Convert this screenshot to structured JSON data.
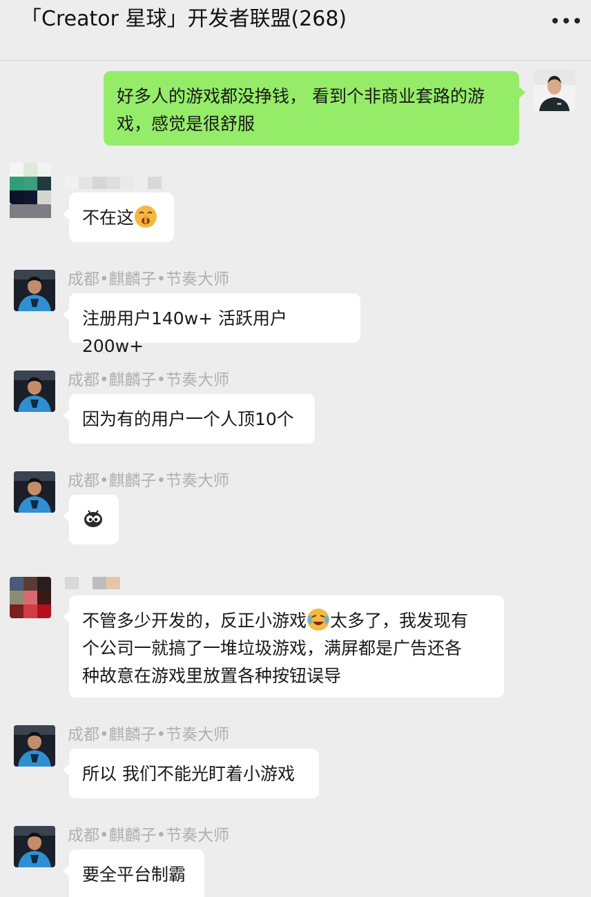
{
  "header": {
    "title": "「Creator 星球」开发者联盟(268)",
    "more_icon": "more-dots-icon"
  },
  "messages": [
    {
      "direction": "out",
      "text": "好多人的游戏都没挣钱， 看到个非商业套路的游戏，感觉是很舒服",
      "line1": "好多人的游戏都没挣钱， 看到个非商业套路的游",
      "line2": "戏，感觉是很舒服"
    },
    {
      "direction": "in",
      "sender": "",
      "text_before_emoji": "不在这",
      "emoji": "shush-face-icon"
    },
    {
      "direction": "in",
      "sender": "成都•麒麟子•节奏大师",
      "text": "注册用户140w+ 活跃用户200w+"
    },
    {
      "direction": "in",
      "sender": "成都•麒麟子•节奏大师",
      "text": "因为有的用户一个人顶10个"
    },
    {
      "direction": "in",
      "sender": "成都•麒麟子•节奏大师",
      "emoji": "bug-eyes-icon"
    },
    {
      "direction": "in",
      "sender": "",
      "line1_before_emoji": "不管多少开发的，反正小游戏",
      "emoji": "crying-laughing-icon",
      "line1_after_emoji": "太多了，我发现有",
      "line2": "个公司一就搞了一堆垃圾游戏，满屏都是广告还各",
      "line3": "种故意在游戏里放置各种按钮误导"
    },
    {
      "direction": "in",
      "sender": "成都•麒麟子•节奏大师",
      "text": "所以 我们不能光盯着小游戏"
    },
    {
      "direction": "in",
      "sender": "成都•麒麟子•节奏大师",
      "text": "要全平台制霸"
    }
  ]
}
